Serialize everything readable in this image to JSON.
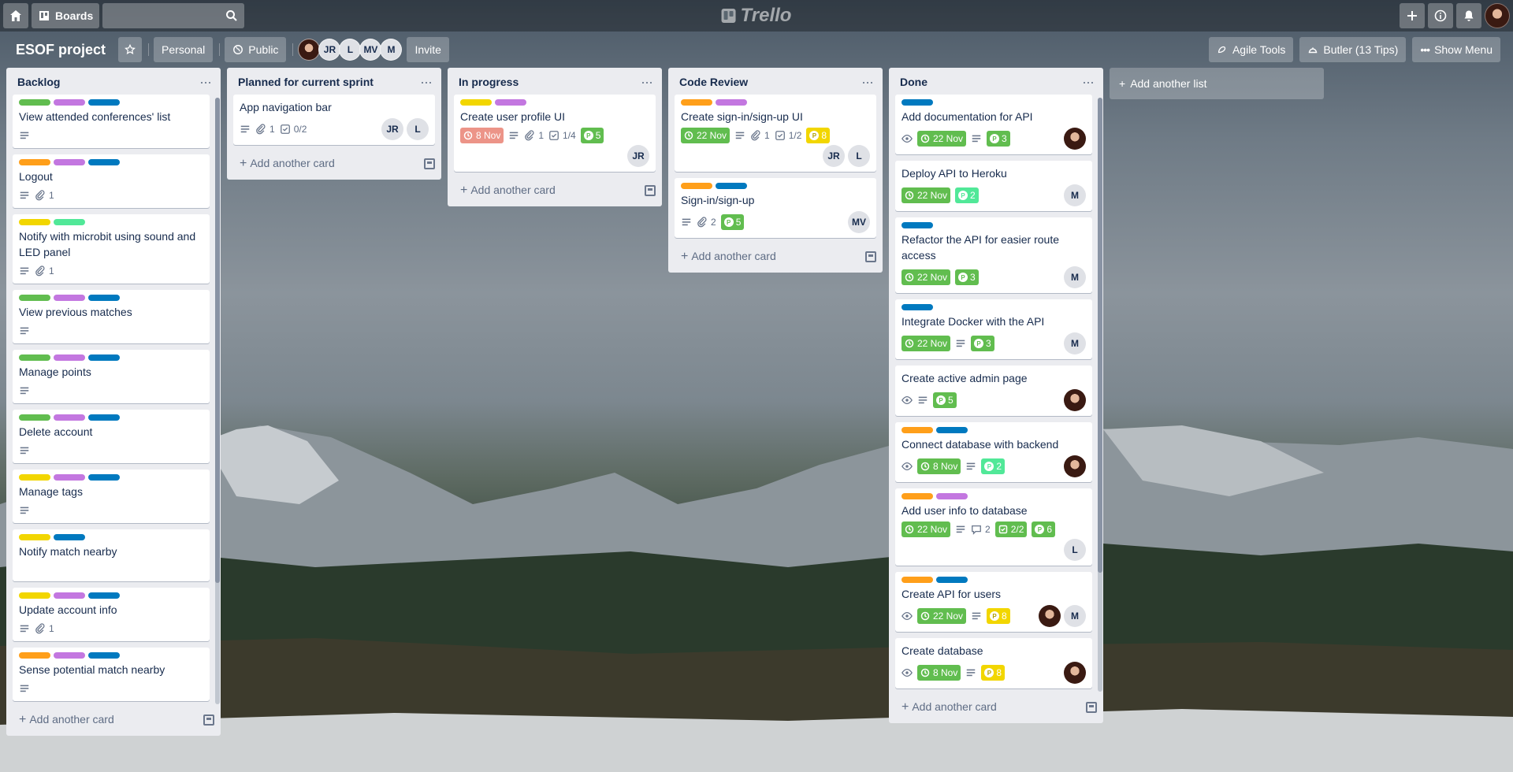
{
  "header": {
    "boards_label": "Boards",
    "logo_text": "Trello",
    "search_placeholder": ""
  },
  "board": {
    "title": "ESOF project",
    "visibility_team": "Personal",
    "visibility": "Public",
    "members": [
      "JR",
      "L",
      "MV",
      "M"
    ],
    "invite_label": "Invite",
    "agile_tools": "Agile Tools",
    "butler": "Butler (13 Tips)",
    "show_menu": "Show Menu"
  },
  "colors": {
    "green": "#61bd4f",
    "purple": "#c377e0",
    "blue": "#0079bf",
    "orange": "#ff9f1a",
    "yellow": "#f2d600",
    "lime": "#51e898",
    "red": "#ec9488"
  },
  "lists": [
    {
      "title": "Backlog",
      "add_card": "Add another card",
      "cards": [
        {
          "labels": [
            "green",
            "purple",
            "blue"
          ],
          "title": "View attended conferences' list",
          "badges": [
            "desc"
          ]
        },
        {
          "labels": [
            "orange",
            "purple",
            "blue"
          ],
          "title": "Logout",
          "badges": [
            "desc"
          ],
          "attachments": "1"
        },
        {
          "labels": [
            "yellow",
            "lime"
          ],
          "title": "Notify with microbit using sound and LED panel",
          "badges": [
            "desc"
          ],
          "attachments": "1"
        },
        {
          "labels": [
            "green",
            "purple",
            "blue"
          ],
          "title": "View previous matches",
          "badges": [
            "desc"
          ]
        },
        {
          "labels": [
            "green",
            "purple",
            "blue"
          ],
          "title": "Manage points",
          "badges": [
            "desc"
          ]
        },
        {
          "labels": [
            "green",
            "purple",
            "blue"
          ],
          "title": "Delete account",
          "badges": [
            "desc"
          ]
        },
        {
          "labels": [
            "yellow",
            "purple",
            "blue"
          ],
          "title": "Manage tags",
          "badges": [
            "desc"
          ]
        },
        {
          "labels": [
            "yellow",
            "blue"
          ],
          "title": "Notify match nearby",
          "badges": []
        },
        {
          "labels": [
            "yellow",
            "purple",
            "blue"
          ],
          "title": "Update account info",
          "badges": [
            "desc"
          ],
          "attachments": "1"
        },
        {
          "labels": [
            "orange",
            "purple",
            "blue"
          ],
          "title": "Sense potential match nearby",
          "badges": [
            "desc"
          ]
        }
      ]
    },
    {
      "title": "Planned for current sprint",
      "add_card": "Add another card",
      "cards": [
        {
          "labels": [],
          "title": "App navigation bar",
          "badges": [
            "desc"
          ],
          "attachments": "1",
          "checklist": "0/2",
          "members": [
            "JR",
            "L"
          ]
        }
      ]
    },
    {
      "title": "In progress",
      "add_card": "Add another card",
      "cards": [
        {
          "labels": [
            "yellow",
            "purple"
          ],
          "title": "Create user profile UI",
          "due": {
            "text": "8 Nov",
            "color": "red"
          },
          "badges": [
            "desc"
          ],
          "attachments": "1",
          "checklist": "1/4",
          "points": {
            "value": "5",
            "color": "green"
          },
          "members_row": [
            "JR"
          ]
        }
      ]
    },
    {
      "title": "Code Review",
      "add_card": "Add another card",
      "cards": [
        {
          "labels": [
            "orange",
            "purple"
          ],
          "title": "Create sign-in/sign-up UI",
          "due": {
            "text": "22 Nov",
            "color": "green"
          },
          "badges": [
            "desc"
          ],
          "attachments": "1",
          "checklist": "1/2",
          "points": {
            "value": "8",
            "color": "yellow"
          },
          "members_row": [
            "JR",
            "L"
          ]
        },
        {
          "labels": [
            "orange",
            "blue"
          ],
          "title": "Sign-in/sign-up",
          "badges": [
            "desc"
          ],
          "attachments": "2",
          "points": {
            "value": "5",
            "color": "green"
          },
          "members": [
            "MV"
          ]
        }
      ]
    },
    {
      "title": "Done",
      "add_card": "Add another card",
      "cards": [
        {
          "labels": [
            "blue"
          ],
          "title": "Add documentation for API",
          "watch": true,
          "due": {
            "text": "22 Nov",
            "color": "green"
          },
          "badges": [
            "desc"
          ],
          "points": {
            "value": "3",
            "color": "green"
          },
          "members": [
            "photo"
          ]
        },
        {
          "labels": [],
          "title": "Deploy API to Heroku",
          "due": {
            "text": "22 Nov",
            "color": "green"
          },
          "points": {
            "value": "2",
            "color": "lime"
          },
          "members": [
            "M"
          ]
        },
        {
          "labels": [
            "blue"
          ],
          "title": "Refactor the API for easier route access",
          "due": {
            "text": "22 Nov",
            "color": "green"
          },
          "points": {
            "value": "3",
            "color": "green"
          },
          "members": [
            "M"
          ]
        },
        {
          "labels": [
            "blue"
          ],
          "title": "Integrate Docker with the API",
          "due": {
            "text": "22 Nov",
            "color": "green"
          },
          "badges": [
            "desc"
          ],
          "points": {
            "value": "3",
            "color": "green"
          },
          "members": [
            "M"
          ]
        },
        {
          "labels": [],
          "title": "Create active admin page",
          "watch": true,
          "badges": [
            "desc"
          ],
          "points": {
            "value": "5",
            "color": "green"
          },
          "members": [
            "photo"
          ]
        },
        {
          "labels": [
            "orange",
            "blue"
          ],
          "title": "Connect database with backend",
          "watch": true,
          "due": {
            "text": "8 Nov",
            "color": "green"
          },
          "badges": [
            "desc"
          ],
          "points": {
            "value": "2",
            "color": "lime"
          },
          "members": [
            "photo"
          ]
        },
        {
          "labels": [
            "orange",
            "purple"
          ],
          "title": "Add user info to database",
          "due": {
            "text": "22 Nov",
            "color": "green"
          },
          "badges": [
            "desc"
          ],
          "comments": "2",
          "checklist_done": "2/2",
          "points": {
            "value": "6",
            "color": "green"
          },
          "members_row": [
            "L"
          ]
        },
        {
          "labels": [
            "orange",
            "blue"
          ],
          "title": "Create API for users",
          "watch": true,
          "due": {
            "text": "22 Nov",
            "color": "green"
          },
          "badges": [
            "desc"
          ],
          "points": {
            "value": "8",
            "color": "yellow"
          },
          "members": [
            "photo",
            "M"
          ]
        },
        {
          "labels": [],
          "title": "Create database",
          "watch": true,
          "due": {
            "text": "8 Nov",
            "color": "green"
          },
          "badges": [
            "desc"
          ],
          "points": {
            "value": "8",
            "color": "yellow"
          },
          "members": [
            "photo"
          ]
        }
      ]
    }
  ],
  "add_list": "Add another list"
}
